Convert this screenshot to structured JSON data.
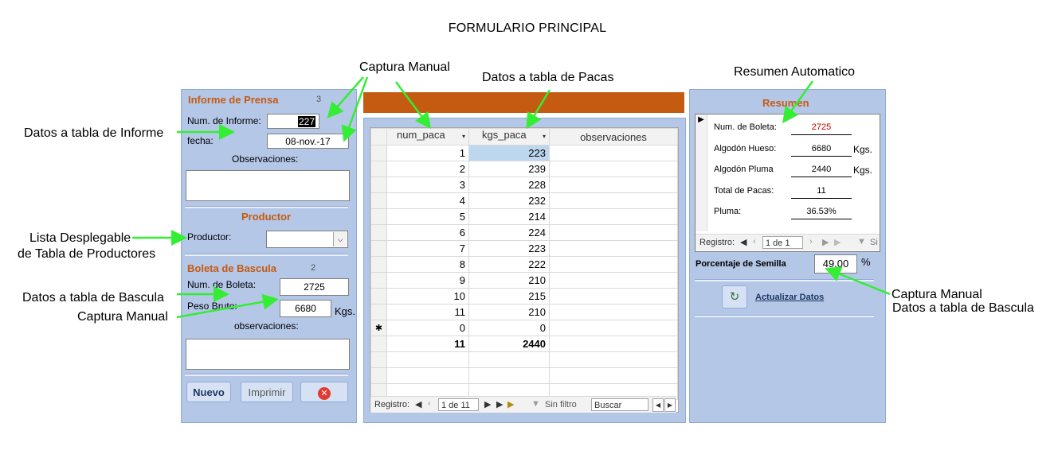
{
  "page_title": "FORMULARIO PRINCIPAL",
  "annotations": {
    "captura_manual_top": "Captura Manual",
    "datos_pacas": "Datos a tabla de Pacas",
    "resumen_auto": "Resumen Automatico",
    "datos_informe": "Datos a tabla de Informe",
    "lista_desplegable_1": "Lista Desplegable",
    "lista_desplegable_2": "de Tabla de Productores",
    "datos_bascula_left": "Datos a tabla de Bascula",
    "captura_manual_left": "Captura Manual",
    "captura_manual_right": "Captura Manual",
    "datos_bascula_right": "Datos a tabla de Bascula"
  },
  "informe": {
    "title": "Informe de Prensa",
    "number": "3",
    "num_label": "Num. de Informe:",
    "num_value": "227",
    "fecha_label": "fecha:",
    "fecha_value": "08-nov.-17",
    "obs_label": "Observaciones:"
  },
  "productor": {
    "title": "Productor",
    "label": "Productor:",
    "value": ""
  },
  "boleta": {
    "title": "Boleta de Bascula",
    "number": "2",
    "num_label": "Num. de Boleta:",
    "num_value": "2725",
    "peso_label": "Peso Bruto:",
    "peso_value": "6680",
    "peso_unit": "Kgs.",
    "obs_label": "observaciones:"
  },
  "buttons": {
    "nuevo": "Nuevo",
    "imprimir": "Imprimir",
    "close_icon": "close-icon"
  },
  "grid": {
    "columns": [
      "num_paca",
      "kgs_paca",
      "observaciones"
    ],
    "rows": [
      [
        "1",
        "223",
        ""
      ],
      [
        "2",
        "239",
        ""
      ],
      [
        "3",
        "228",
        ""
      ],
      [
        "4",
        "232",
        ""
      ],
      [
        "5",
        "214",
        ""
      ],
      [
        "6",
        "224",
        ""
      ],
      [
        "7",
        "223",
        ""
      ],
      [
        "8",
        "222",
        ""
      ],
      [
        "9",
        "210",
        ""
      ],
      [
        "10",
        "215",
        ""
      ],
      [
        "11",
        "210",
        ""
      ]
    ],
    "new_row": [
      "0",
      "0",
      ""
    ],
    "totals": [
      "11",
      "2440",
      ""
    ],
    "nav": {
      "label": "Registro:",
      "position": "1 de 11",
      "filter": "Sin filtro",
      "search": "Buscar"
    }
  },
  "resumen": {
    "title": "Resumen",
    "rows": [
      {
        "label": "Num. de Boleta:",
        "value": "2725",
        "unit": ""
      },
      {
        "label": "Algodón Hueso:",
        "value": "6680",
        "unit": "Kgs."
      },
      {
        "label": "Algodón Pluma",
        "value": "2440",
        "unit": "Kgs."
      },
      {
        "label": "Total de Pacas:",
        "value": "11",
        "unit": ""
      },
      {
        "label": "Pluma:",
        "value": "36.53%",
        "unit": ""
      }
    ],
    "nav": {
      "label": "Registro:",
      "position": "1 de 1",
      "filter": "Si"
    },
    "semilla_label": "Porcentaje de Semilla",
    "semilla_value": "49.00",
    "semilla_unit": "%",
    "actualizar": "Actualizar Datos"
  },
  "colors": {
    "panel": "#b4c7e7",
    "section_title": "#c55a11",
    "header_bar": "#c55a11",
    "arrow": "#33ee33",
    "boleta_value": "#c00000"
  }
}
